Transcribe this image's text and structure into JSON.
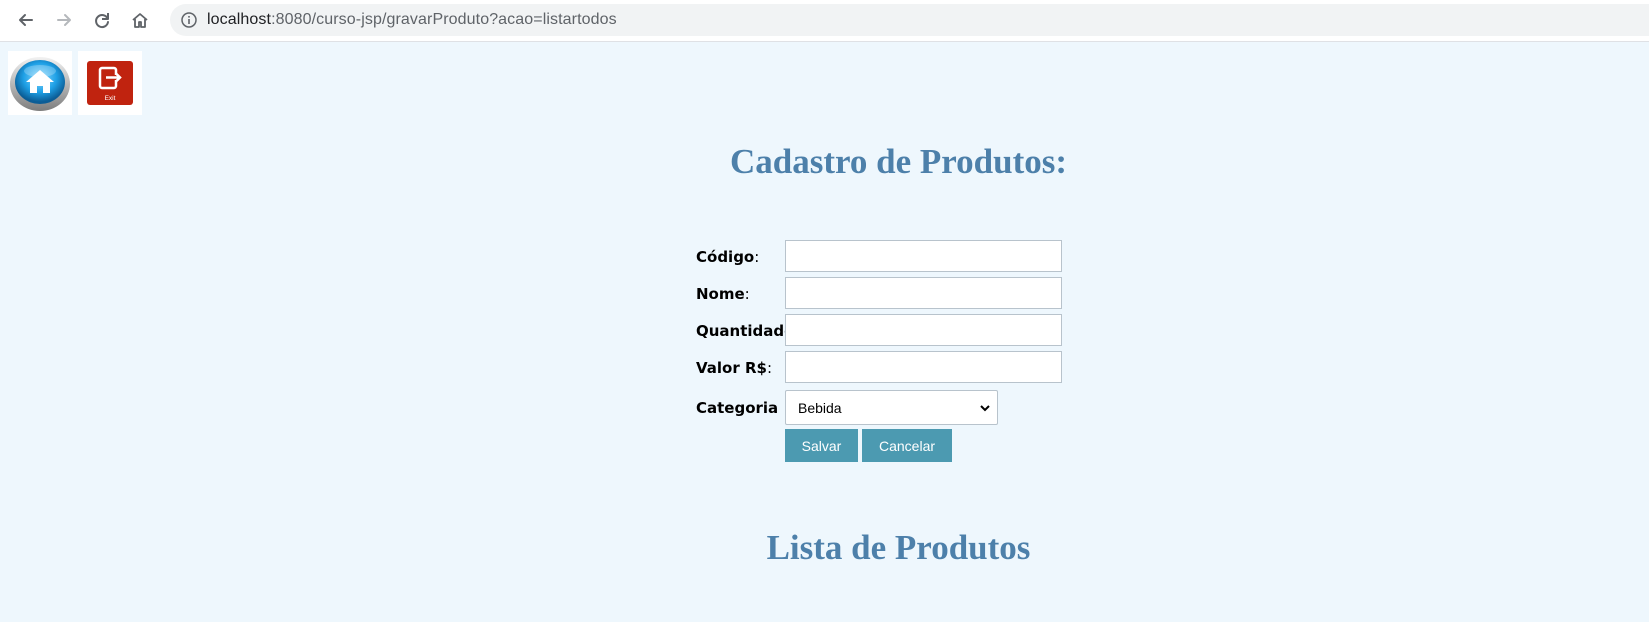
{
  "browser": {
    "url_host": "localhost",
    "url_rest": ":8080/curso-jsp/gravarProduto?acao=listartodos",
    "icons": [
      "back-arrow-icon",
      "forward-arrow-icon",
      "reload-icon",
      "home-icon",
      "info-icon"
    ]
  },
  "page": {
    "nav_icons": [
      "home-icon",
      "exit-icon"
    ],
    "exit_icon_text": "Exit",
    "form_title": "Cadastro de Produtos:",
    "list_title": "Lista de Produtos"
  },
  "form": {
    "codigo_label": "Código",
    "nome_label": "Nome",
    "quantidade_label": "Quantidade",
    "valor_label": "Valor R$",
    "categoria_label": "Categoria",
    "colon": ":",
    "codigo_value": "",
    "nome_value": "",
    "quantidade_value": "",
    "valor_value": "",
    "categoria_selected": "Bebida",
    "save_label": "Salvar",
    "cancel_label": "Cancelar"
  },
  "colors": {
    "page_background": "#eef7fd",
    "title": "#4d80aa",
    "button": "#4c9ab1",
    "exit_icon": "#c0230f"
  }
}
